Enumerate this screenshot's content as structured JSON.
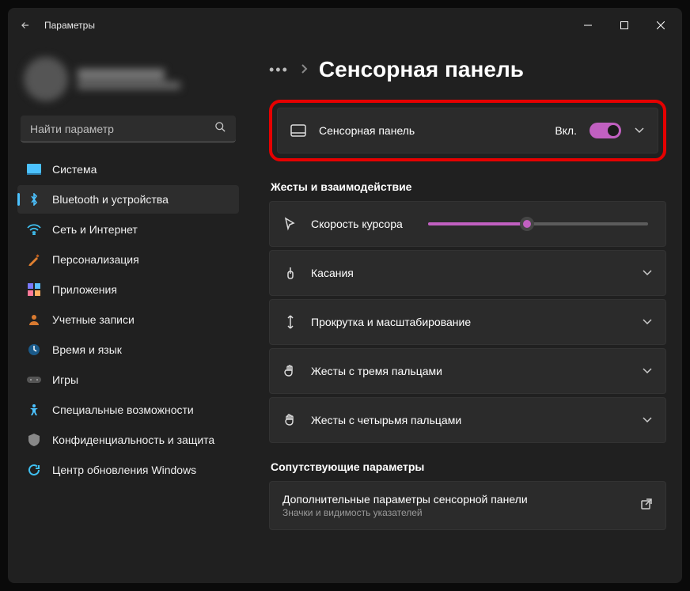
{
  "app_title": "Параметры",
  "search_placeholder": "Найти параметр",
  "sidebar": {
    "items": [
      {
        "label": "Система"
      },
      {
        "label": "Bluetooth и устройства"
      },
      {
        "label": "Сеть и Интернет"
      },
      {
        "label": "Персонализация"
      },
      {
        "label": "Приложения"
      },
      {
        "label": "Учетные записи"
      },
      {
        "label": "Время и язык"
      },
      {
        "label": "Игры"
      },
      {
        "label": "Специальные возможности"
      },
      {
        "label": "Конфиденциальность и защита"
      },
      {
        "label": "Центр обновления Windows"
      }
    ],
    "selected_index": 1
  },
  "breadcrumb": {
    "overflow": "•••",
    "current": "Сенсорная панель"
  },
  "touchpad_card": {
    "label": "Сенсорная панель",
    "state_text": "Вкл.",
    "toggle_on": true
  },
  "sections": {
    "gestures_title": "Жесты и взаимодействие",
    "related_title": "Сопутствующие параметры"
  },
  "gesture_items": [
    {
      "label": "Скорость курсора",
      "type": "slider",
      "value_percent": 45
    },
    {
      "label": "Касания",
      "type": "expand"
    },
    {
      "label": "Прокрутка и масштабирование",
      "type": "expand"
    },
    {
      "label": "Жесты с тремя пальцами",
      "type": "expand"
    },
    {
      "label": "Жесты с четырьмя пальцами",
      "type": "expand"
    }
  ],
  "related_card": {
    "title": "Дополнительные параметры сенсорной панели",
    "subtitle": "Значки и видимость указателей"
  }
}
